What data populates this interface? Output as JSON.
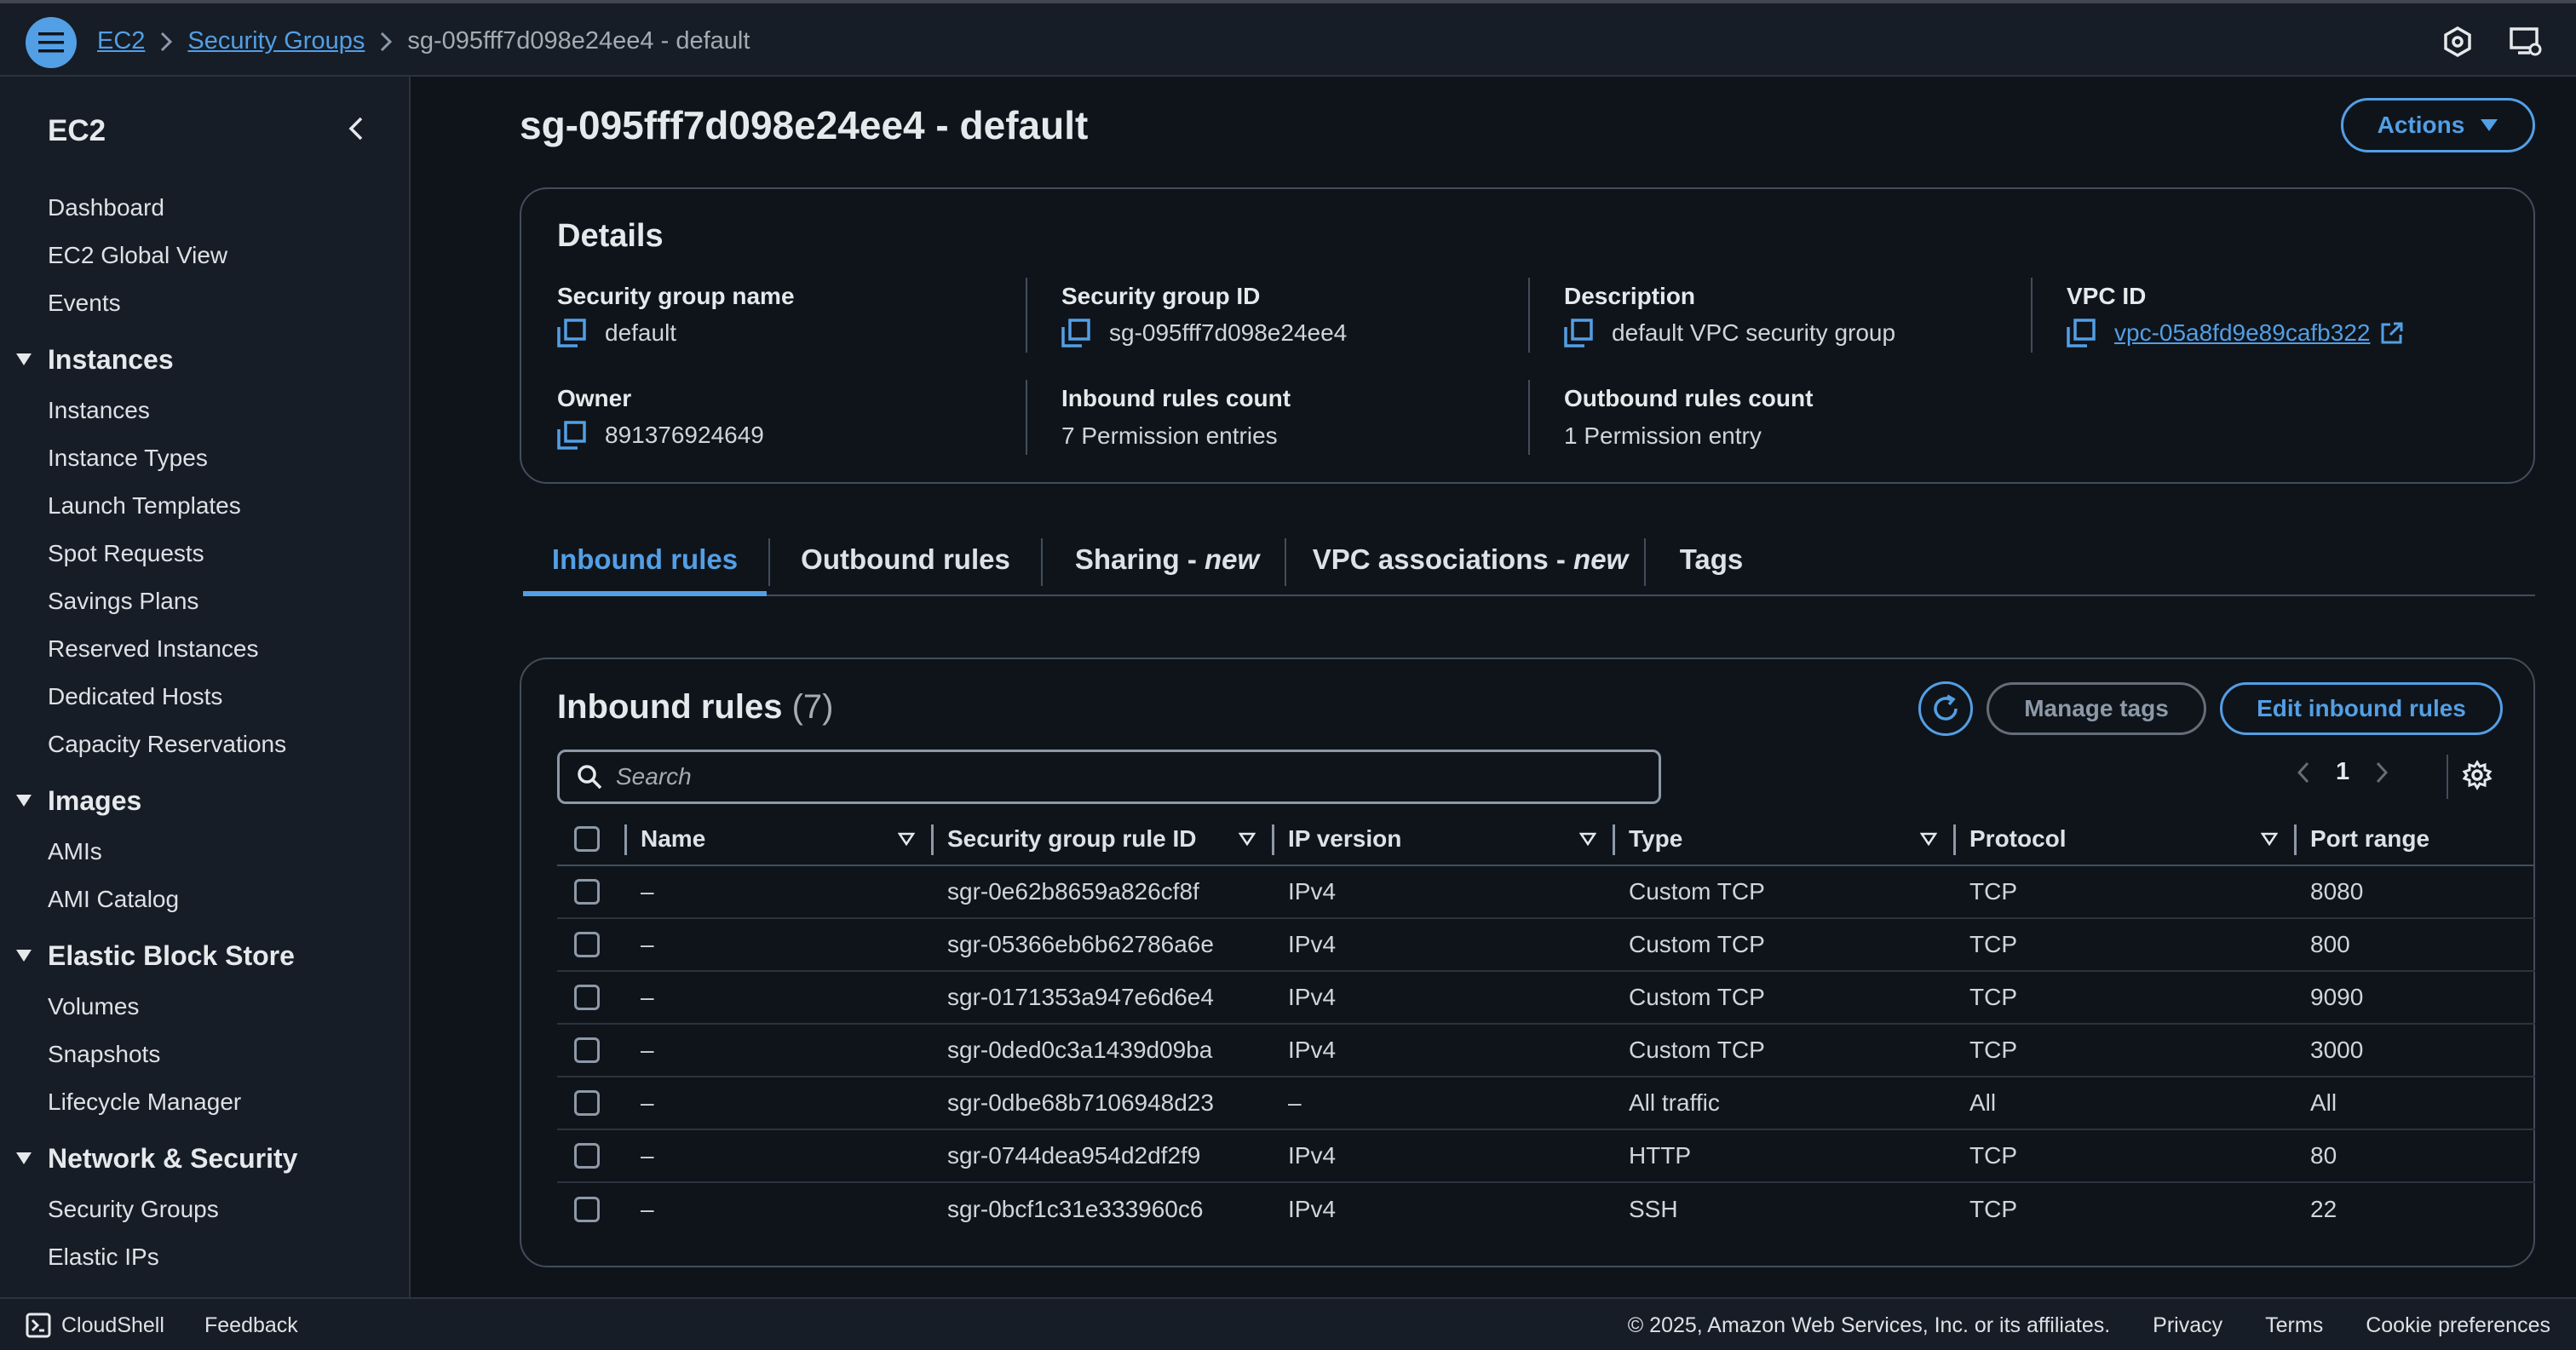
{
  "breadcrumb": {
    "ec2": "EC2",
    "security_groups": "Security Groups",
    "current": "sg-095fff7d098e24ee4 - default"
  },
  "sidebar": {
    "title": "EC2",
    "top_items": [
      "Dashboard",
      "EC2 Global View",
      "Events"
    ],
    "sections": [
      {
        "title": "Instances",
        "items": [
          "Instances",
          "Instance Types",
          "Launch Templates",
          "Spot Requests",
          "Savings Plans",
          "Reserved Instances",
          "Dedicated Hosts",
          "Capacity Reservations"
        ]
      },
      {
        "title": "Images",
        "items": [
          "AMIs",
          "AMI Catalog"
        ]
      },
      {
        "title": "Elastic Block Store",
        "items": [
          "Volumes",
          "Snapshots",
          "Lifecycle Manager"
        ]
      },
      {
        "title": "Network & Security",
        "items": [
          "Security Groups",
          "Elastic IPs"
        ]
      }
    ]
  },
  "page": {
    "title": "sg-095fff7d098e24ee4 - default",
    "actions_label": "Actions"
  },
  "details": {
    "heading": "Details",
    "sg_name_label": "Security group name",
    "sg_name_value": "default",
    "sg_id_label": "Security group ID",
    "sg_id_value": "sg-095fff7d098e24ee4",
    "description_label": "Description",
    "description_value": "default VPC security group",
    "vpc_id_label": "VPC ID",
    "vpc_id_value": "vpc-05a8fd9e89cafb322",
    "owner_label": "Owner",
    "owner_value": "891376924649",
    "inbound_count_label": "Inbound rules count",
    "inbound_count_value": "7 Permission entries",
    "outbound_count_label": "Outbound rules count",
    "outbound_count_value": "1 Permission entry"
  },
  "tabs": {
    "inbound": "Inbound rules",
    "outbound": "Outbound rules",
    "sharing": "Sharing - ",
    "sharing_new": "new",
    "vpc_assoc": "VPC associations - ",
    "vpc_assoc_new": "new",
    "tags": "Tags"
  },
  "rules": {
    "heading": "Inbound rules",
    "count": "(7)",
    "manage_tags": "Manage tags",
    "edit_inbound": "Edit inbound rules",
    "search_placeholder": "Search",
    "page": "1",
    "columns": {
      "name": "Name",
      "rule_id": "Security group rule ID",
      "ip_version": "IP version",
      "type": "Type",
      "protocol": "Protocol",
      "port_range": "Port range"
    },
    "rows": [
      {
        "name": "–",
        "rule_id": "sgr-0e62b8659a826cf8f",
        "ip_version": "IPv4",
        "type": "Custom TCP",
        "protocol": "TCP",
        "port_range": "8080"
      },
      {
        "name": "–",
        "rule_id": "sgr-05366eb6b62786a6e",
        "ip_version": "IPv4",
        "type": "Custom TCP",
        "protocol": "TCP",
        "port_range": "800"
      },
      {
        "name": "–",
        "rule_id": "sgr-0171353a947e6d6e4",
        "ip_version": "IPv4",
        "type": "Custom TCP",
        "protocol": "TCP",
        "port_range": "9090"
      },
      {
        "name": "–",
        "rule_id": "sgr-0ded0c3a1439d09ba",
        "ip_version": "IPv4",
        "type": "Custom TCP",
        "protocol": "TCP",
        "port_range": "3000"
      },
      {
        "name": "–",
        "rule_id": "sgr-0dbe68b7106948d23",
        "ip_version": "–",
        "type": "All traffic",
        "protocol": "All",
        "port_range": "All"
      },
      {
        "name": "–",
        "rule_id": "sgr-0744dea954d2df2f9",
        "ip_version": "IPv4",
        "type": "HTTP",
        "protocol": "TCP",
        "port_range": "80"
      },
      {
        "name": "–",
        "rule_id": "sgr-0bcf1c31e333960c6",
        "ip_version": "IPv4",
        "type": "SSH",
        "protocol": "TCP",
        "port_range": "22"
      }
    ]
  },
  "footer": {
    "cloudshell": "CloudShell",
    "feedback": "Feedback",
    "copyright": "© 2025, Amazon Web Services, Inc. or its affiliates.",
    "privacy": "Privacy",
    "terms": "Terms",
    "cookie": "Cookie preferences"
  },
  "icons": {
    "menu": "hamburger-icon",
    "notifications": "hexagon-gear-icon",
    "display": "display-settings-icon",
    "copy": "copy-icon",
    "external": "external-link-icon",
    "refresh": "refresh-icon",
    "search": "search-icon",
    "settings": "gear-icon"
  },
  "colors": {
    "accent": "#539fe5",
    "background": "#0f141a",
    "panel": "#161d26",
    "border": "#414d5c"
  }
}
